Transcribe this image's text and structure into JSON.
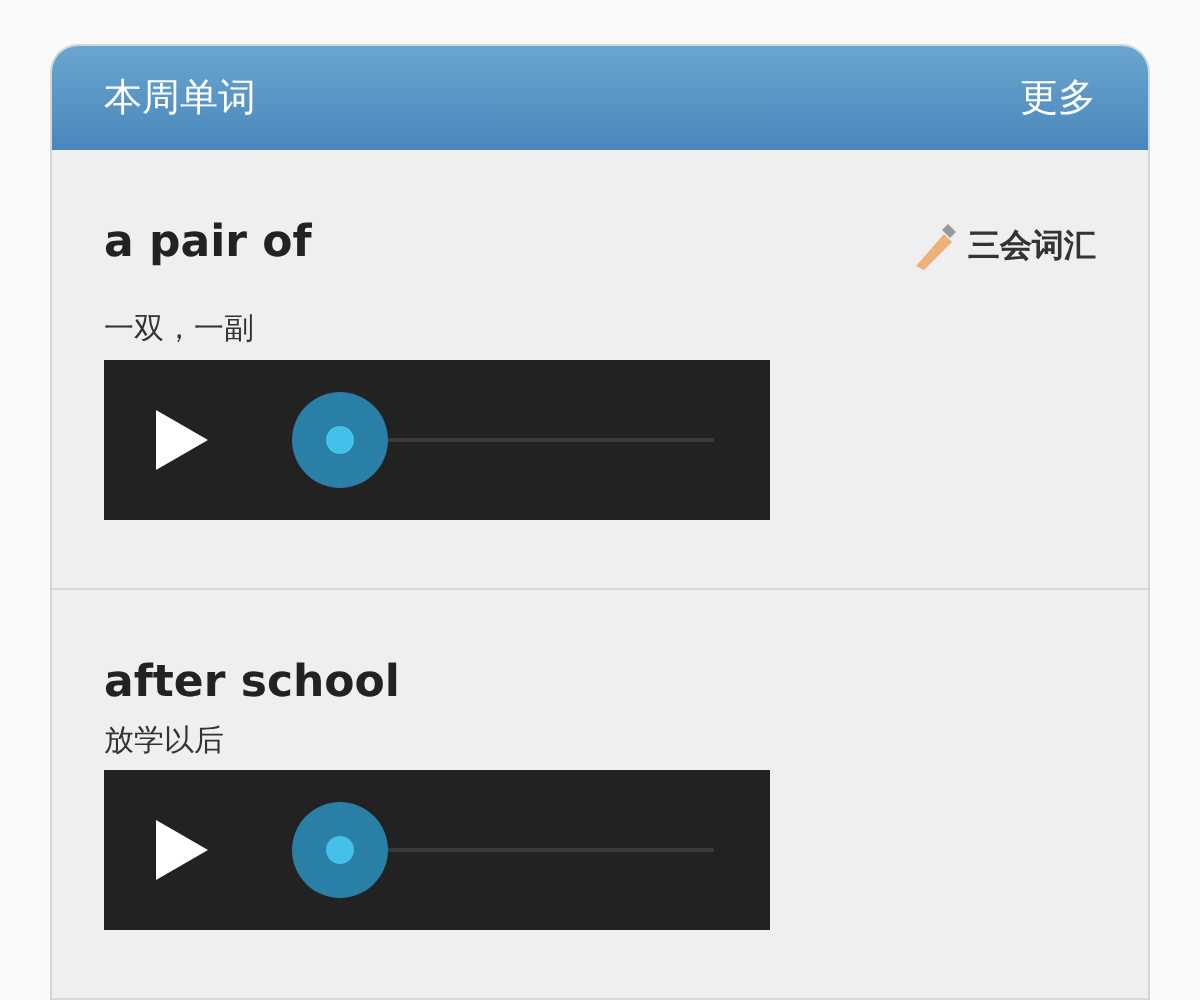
{
  "header": {
    "title": "本周单词",
    "more": "更多"
  },
  "words": [
    {
      "word": "a pair of",
      "meaning": "一双，一副",
      "tag": "三会词汇"
    },
    {
      "word": "after school",
      "meaning": "放学以后"
    }
  ]
}
